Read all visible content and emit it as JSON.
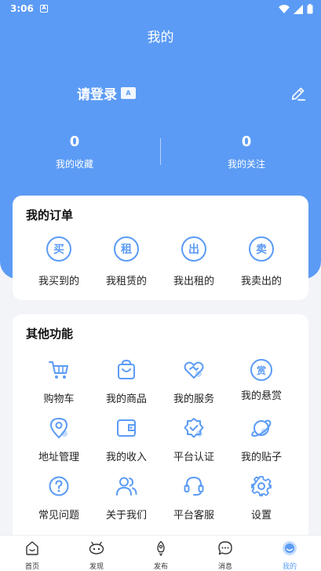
{
  "status_bar": {
    "time": "3:06",
    "notif_icon": "A"
  },
  "header": {
    "title": "我的"
  },
  "profile": {
    "login_text": "请登录",
    "badge_icon": "A"
  },
  "stats": [
    {
      "count": "0",
      "label": "我的收藏"
    },
    {
      "count": "0",
      "label": "我的关注"
    }
  ],
  "orders": {
    "title": "我的订单",
    "items": [
      {
        "char": "买",
        "label": "我买到的"
      },
      {
        "char": "租",
        "label": "我租赁的"
      },
      {
        "char": "出",
        "label": "我出租的"
      },
      {
        "char": "卖",
        "label": "我卖出的"
      }
    ]
  },
  "other": {
    "title": "其他功能",
    "items": [
      {
        "label": "购物车",
        "icon": "cart-icon"
      },
      {
        "label": "我的商品",
        "icon": "bag-icon"
      },
      {
        "label": "我的服务",
        "icon": "heart-handshake-icon"
      },
      {
        "label": "我的悬赏",
        "icon": "reward-icon",
        "char": "赏"
      },
      {
        "label": "地址管理",
        "icon": "location-icon"
      },
      {
        "label": "我的收入",
        "icon": "wallet-icon"
      },
      {
        "label": "平台认证",
        "icon": "verified-badge-icon"
      },
      {
        "label": "我的贴子",
        "icon": "planet-icon"
      },
      {
        "label": "常见问题",
        "icon": "question-icon"
      },
      {
        "label": "关于我们",
        "icon": "users-icon"
      },
      {
        "label": "平台客服",
        "icon": "headset-icon"
      },
      {
        "label": "设置",
        "icon": "gear-icon"
      }
    ]
  },
  "tabbar": {
    "active": "我的",
    "accent": "#5b9bf5",
    "items": [
      {
        "label": "首页",
        "icon": "home-icon"
      },
      {
        "label": "发现",
        "icon": "discover-icon"
      },
      {
        "label": "发布",
        "icon": "rocket-icon"
      },
      {
        "label": "消息",
        "icon": "message-icon"
      },
      {
        "label": "我的",
        "icon": "profile-icon"
      }
    ]
  }
}
